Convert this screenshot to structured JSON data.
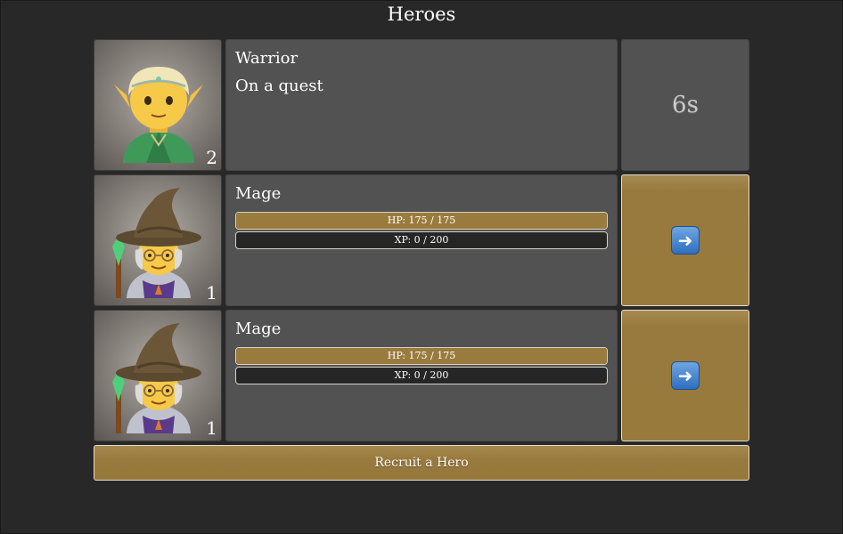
{
  "header": {
    "title": "Heroes"
  },
  "heroes": [
    {
      "class": "Warrior",
      "portrait_icon": "elf-icon",
      "level": "2",
      "status": "On a quest",
      "timer": "6s"
    },
    {
      "class": "Mage",
      "portrait_icon": "mage-icon",
      "level": "1",
      "hp_label": "HP: 175 / 175",
      "hp_fraction": 1.0,
      "xp_label": "XP: 0 / 200",
      "xp_fraction": 0.0,
      "action_icon": "right-arrow-icon",
      "action_glyph": "➜"
    },
    {
      "class": "Mage",
      "portrait_icon": "mage-icon",
      "level": "1",
      "hp_label": "HP: 175 / 175",
      "hp_fraction": 1.0,
      "xp_label": "XP: 0 / 200",
      "xp_fraction": 0.0,
      "action_icon": "right-arrow-icon",
      "action_glyph": "➜"
    }
  ],
  "footer": {
    "recruit_label": "Recruit a Hero"
  },
  "colors": {
    "background": "#282828",
    "panel": "#525252",
    "accent_gold": "#997a3e",
    "bar_empty": "#262626"
  }
}
